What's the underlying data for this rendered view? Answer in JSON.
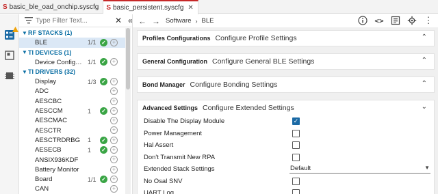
{
  "tabs": [
    {
      "label": "basic_ble_oad_onchip.syscfg",
      "active": false
    },
    {
      "label": "basic_persistent.syscfg",
      "active": true
    }
  ],
  "filter": {
    "placeholder": "Type Filter Text..."
  },
  "tree": [
    {
      "kind": "cat",
      "label": "RF STACKS (1)"
    },
    {
      "kind": "item",
      "label": "BLE",
      "count": "1/1",
      "checked": true,
      "selected": true
    },
    {
      "kind": "cat",
      "label": "TI DEVICES (1)"
    },
    {
      "kind": "item",
      "label": "Device Configur...",
      "count": "1/1",
      "checked": true
    },
    {
      "kind": "cat",
      "label": "TI DRIVERS (32)"
    },
    {
      "kind": "item",
      "label": "Display",
      "count": "1/3",
      "checked": true
    },
    {
      "kind": "item",
      "label": "ADC",
      "count": "",
      "checked": false
    },
    {
      "kind": "item",
      "label": "AESCBC",
      "count": "",
      "checked": false
    },
    {
      "kind": "item",
      "label": "AESCCM",
      "count": "1",
      "checked": true
    },
    {
      "kind": "item",
      "label": "AESCMAC",
      "count": "",
      "checked": false
    },
    {
      "kind": "item",
      "label": "AESCTR",
      "count": "",
      "checked": false
    },
    {
      "kind": "item",
      "label": "AESCTRDRBG",
      "count": "1",
      "checked": true
    },
    {
      "kind": "item",
      "label": "AESECB",
      "count": "1",
      "checked": true
    },
    {
      "kind": "item",
      "label": "ANSIX936KDF",
      "count": "",
      "checked": false
    },
    {
      "kind": "item",
      "label": "Battery Monitor",
      "count": "",
      "checked": false
    },
    {
      "kind": "item",
      "label": "Board",
      "count": "1/1",
      "checked": true
    },
    {
      "kind": "item",
      "label": "CAN",
      "count": "",
      "checked": false
    }
  ],
  "breadcrumb": [
    "Software",
    "BLE"
  ],
  "panels": [
    {
      "title": "Profiles Configurations",
      "desc": "Configure Profile Settings"
    },
    {
      "title": "General Configuration",
      "desc": "Configure General BLE Settings"
    },
    {
      "title": "Bond Manager",
      "desc": "Configure Bonding Settings"
    },
    {
      "title": "Advanced Settings",
      "desc": "Configure Extended Settings"
    }
  ],
  "advanced_settings": [
    {
      "label": "Disable The Display Module",
      "type": "checkbox",
      "checked": true
    },
    {
      "label": "Power Management",
      "type": "checkbox",
      "checked": false
    },
    {
      "label": "Hal Assert",
      "type": "checkbox",
      "checked": false
    },
    {
      "label": "Don't Transmit New RPA",
      "type": "checkbox",
      "checked": false
    },
    {
      "label": "Extended Stack Settings",
      "type": "select",
      "value": "Default"
    },
    {
      "label": "No Osal SNV",
      "type": "checkbox",
      "checked": false
    },
    {
      "label": "UART Log",
      "type": "checkbox",
      "checked": false
    }
  ],
  "colors": {
    "accent": "#0b6fa4",
    "check": "#3aa545",
    "checkbox_on": "#1b6aa5",
    "tab_marker": "#c62828"
  }
}
